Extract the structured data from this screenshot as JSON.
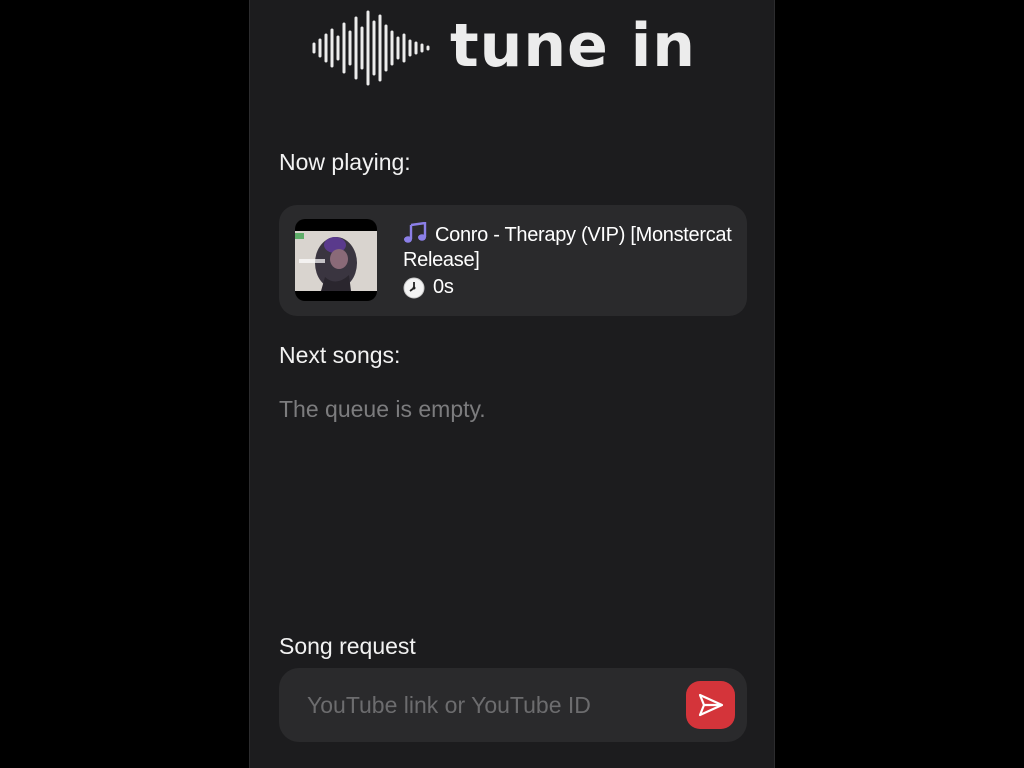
{
  "app": {
    "logo_text": "tune in",
    "accent_color": "#d4343a"
  },
  "now_playing": {
    "label": "Now playing:",
    "track_title": "Conro - Therapy (VIP) [Monstercat Release]",
    "elapsed": "0s",
    "title_icon": "music-note-icon",
    "time_icon": "clock-icon"
  },
  "queue": {
    "label": "Next songs:",
    "empty_message": "The queue is empty."
  },
  "song_request": {
    "label": "Song request",
    "input_value": "",
    "placeholder": "YouTube link or YouTube ID",
    "submit_icon": "send-icon"
  }
}
